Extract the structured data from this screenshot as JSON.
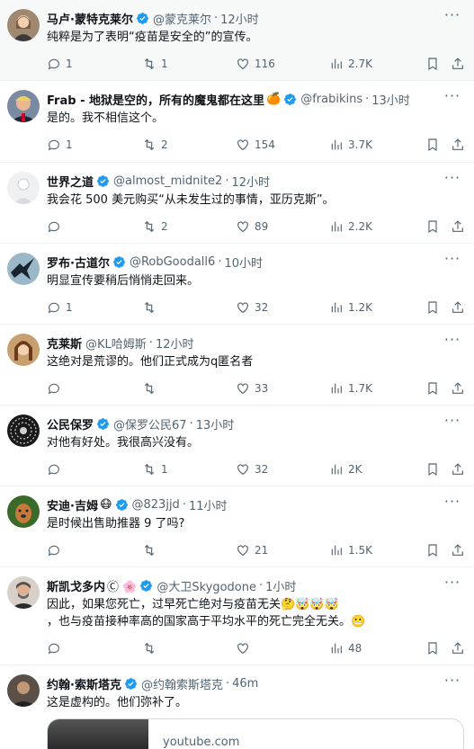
{
  "tweets": [
    {
      "name": "马卢·蒙特克莱尔",
      "handle": "@蒙克莱尔",
      "time": "12小时",
      "text": "纯粹是为了表明“疫苗是安全的”的宣传。",
      "replies": "1",
      "retweets": "1",
      "likes": "116",
      "views": "2.7K",
      "avatar_icon": "woman-portrait"
    },
    {
      "name": "Frab - 地狱是空的，所有的魔鬼都在这里",
      "name_emoji": "🍊",
      "handle": "@frabikins",
      "time": "13小时",
      "text": "是的。我不相信这个。",
      "replies": "1",
      "retweets": "2",
      "likes": "154",
      "views": "3.7K",
      "avatar_icon": "man-portrait"
    },
    {
      "name": "世界之道",
      "handle": "@almost_midnite2",
      "time": "12小时",
      "text": "我会花 500 美元购买“从未发生过的事情，亚历克斯”。",
      "replies": "",
      "retweets": "2",
      "likes": "89",
      "views": "2.2K",
      "avatar_icon": "light-portrait"
    },
    {
      "name": "罗布·古道尔",
      "handle": "@RobGoodall6",
      "time": "10小时",
      "text": "明显宣传要稍后悄悄走回来。",
      "replies": "1",
      "retweets": "",
      "likes": "32",
      "views": "1.2K",
      "avatar_icon": "bird-silhouette"
    },
    {
      "name": "克莱斯",
      "handle": "@KL哈姆斯",
      "time": "12小时",
      "text": "这绝对是荒谬的。他们正式成为q匿名者",
      "replies": "",
      "retweets": "",
      "likes": "33",
      "views": "1.7K",
      "avatar_icon": "woman-portrait"
    },
    {
      "name": "公民保罗",
      "handle": "@保罗公民67",
      "time": "13小时",
      "text": "对他有好处。我很高兴没有。",
      "replies": "",
      "retweets": "1",
      "likes": "32",
      "views": "2K",
      "avatar_icon": "pattern-circle"
    },
    {
      "name": "安迪·吉姆",
      "name_emoji": "😷",
      "handle": "@823jjd",
      "time": "11小时",
      "text": "是时候出售助推器 9 了吗?",
      "replies": "",
      "retweets": "",
      "likes": "21",
      "views": "1.5K",
      "avatar_icon": "dog-portrait"
    },
    {
      "name": "斯凯戈多内",
      "name_emoji": "Ⓒ 🌸",
      "handle": "@大卫Skygodone",
      "time": "1小时",
      "text": "因此，如果您死亡，过早死亡绝对与疫苗无关🤔🤯🤯🤯\n，也与疫苗接种率高的国家高于平均水平的死亡完全无关。😬",
      "replies": "",
      "retweets": "",
      "likes": "",
      "views": "48",
      "avatar_icon": "man-portrait"
    },
    {
      "name": "约翰·索斯塔克",
      "handle": "@约翰索斯塔克",
      "time": "46m",
      "text": "这是虚构的。他们弥补了。",
      "card_site": "youtube.com",
      "avatar_icon": "man-portrait"
    }
  ],
  "colors": {
    "verified": "#1d9bf0",
    "muted": "#536471",
    "text": "#0f1419"
  },
  "icons": [
    "reply-icon",
    "retweet-icon",
    "like-icon",
    "views-icon",
    "bookmark-icon",
    "share-icon",
    "more-icon",
    "verified-icon"
  ]
}
